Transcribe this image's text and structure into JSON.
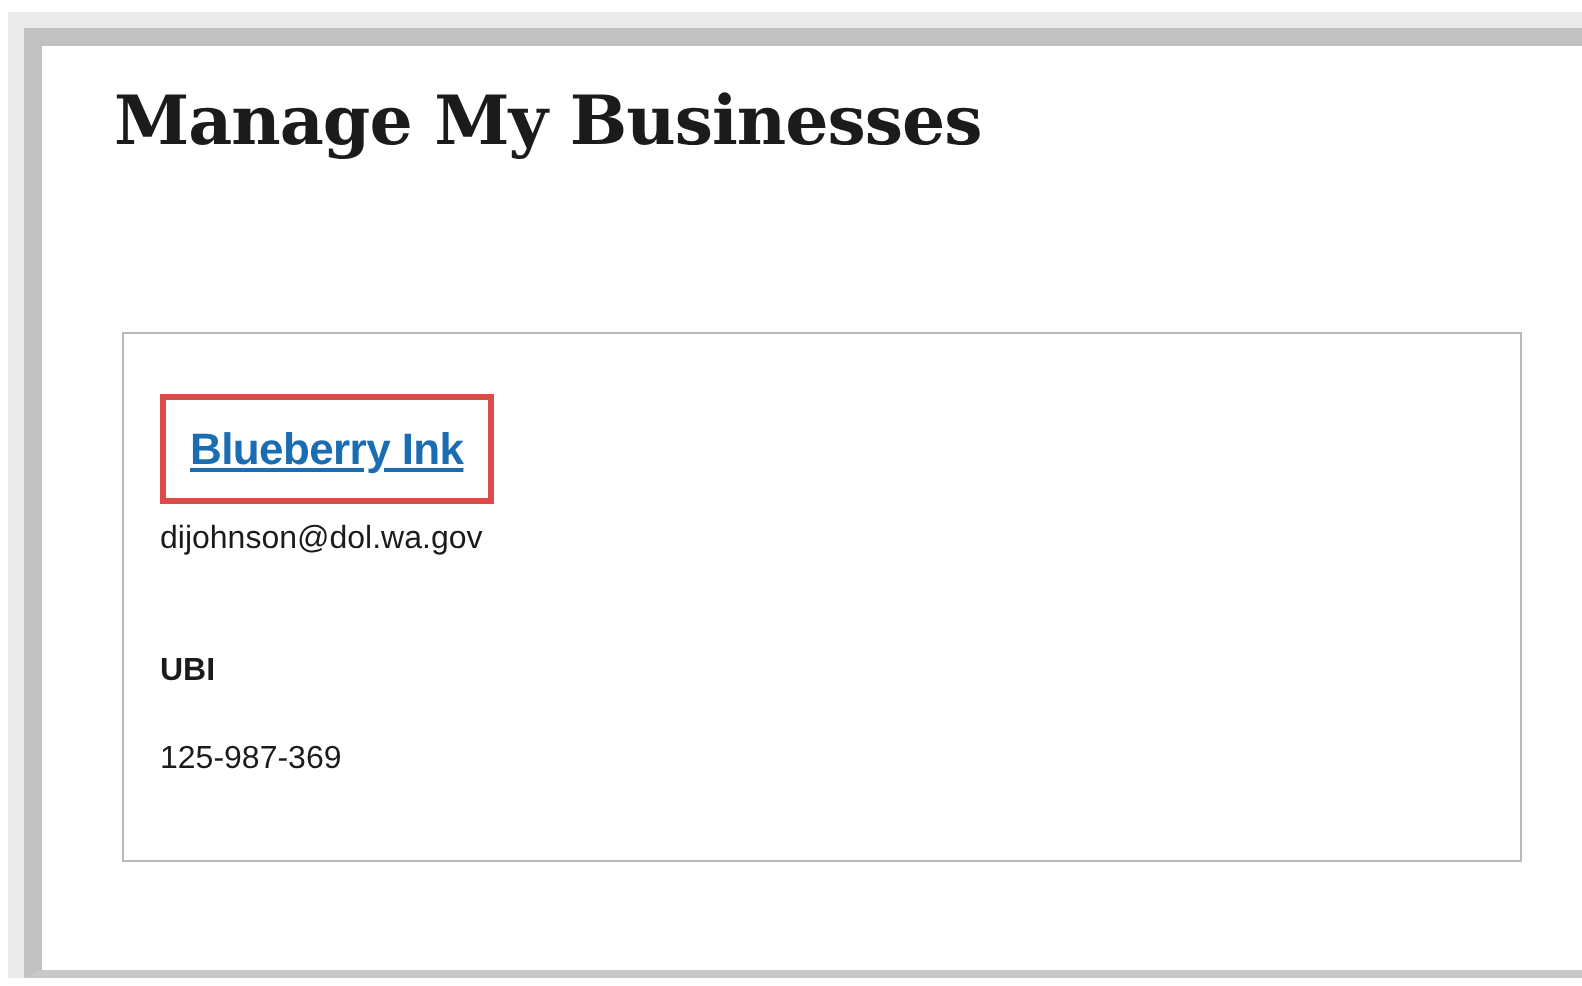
{
  "page": {
    "title": "Manage My Businesses"
  },
  "businesses": [
    {
      "name": "Blueberry Ink",
      "highlighted": true,
      "email": "dijohnson@dol.wa.gov",
      "id_label": "UBI",
      "id_value": "125-987-369"
    }
  ]
}
